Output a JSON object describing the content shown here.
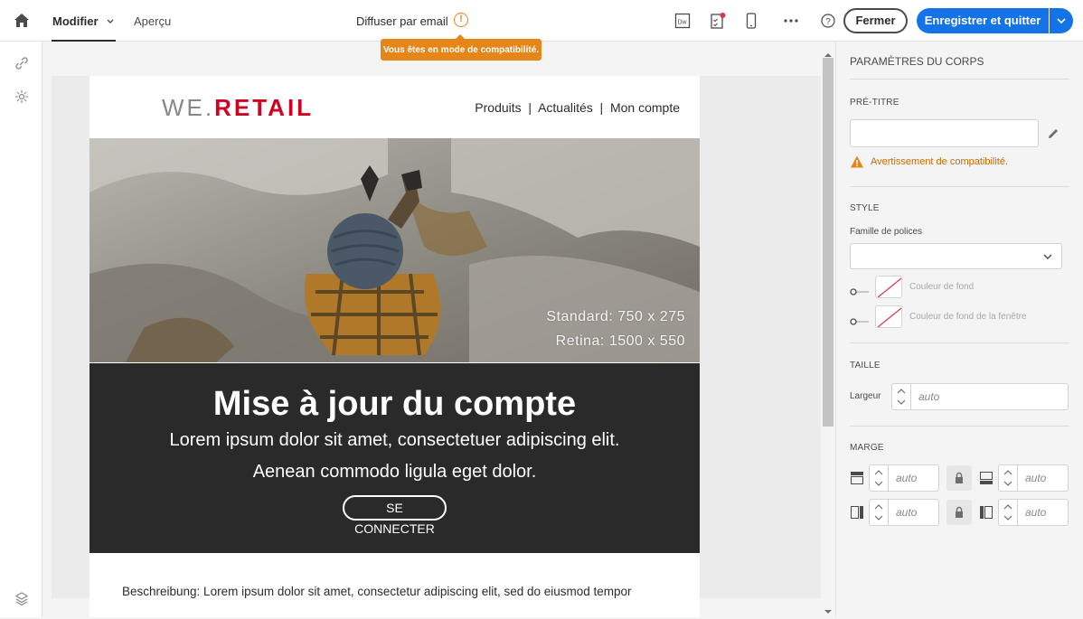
{
  "topbar": {
    "tab_modifier": "Modifier",
    "tab_apercu": "Aperçu",
    "title": "Diffuser par email",
    "warning_glyph": "!",
    "tooltip": "Vous êtes en mode de compatibilité.",
    "close_label": "Fermer",
    "save_label": "Enregistrer et quitter",
    "dw_label": "Dw"
  },
  "email": {
    "logo_we": "WE.",
    "logo_retail": "RETAIL",
    "nav": "Produits  |  Actualités  |  Mon compte",
    "hero_caption_1": "Standard: 750 x 275",
    "hero_caption_2": "Retina: 1500 x 550",
    "headline": "Mise à jour du compte",
    "line1": "Lorem ipsum dolor sit amet, consectetuer adipiscing elit.",
    "line2": "Aenean commodo ligula eget dolor.",
    "button_l1": "SE",
    "button_l2": "CONNECTER",
    "description": "Beschreibung: Lorem ipsum dolor sit amet, consectetur adipiscing elit, sed do eiusmod tempor"
  },
  "panel": {
    "title": "PARAMÈTRES DU CORPS",
    "pretitle_label": "PRÉ-TITRE",
    "pretitle_value": "",
    "compat_warning": "Avertissement de compatibilité.",
    "style_label": "STYLE",
    "font_family_label": "Famille de polices",
    "font_family_value": "",
    "bg_color_label": "Couleur de fond",
    "window_bg_label": "Couleur de fond de la fenêtre",
    "size_label": "TAILLE",
    "width_label": "Largeur",
    "width_value": "auto",
    "margin_label": "MARGE",
    "margin_top": "auto",
    "margin_bottom": "auto",
    "margin_left": "auto",
    "margin_right": "auto"
  },
  "colors": {
    "accent": "#1473e6",
    "warning": "#e68619",
    "brand_red": "#d1021f",
    "dark_block": "#2a2a2a"
  }
}
